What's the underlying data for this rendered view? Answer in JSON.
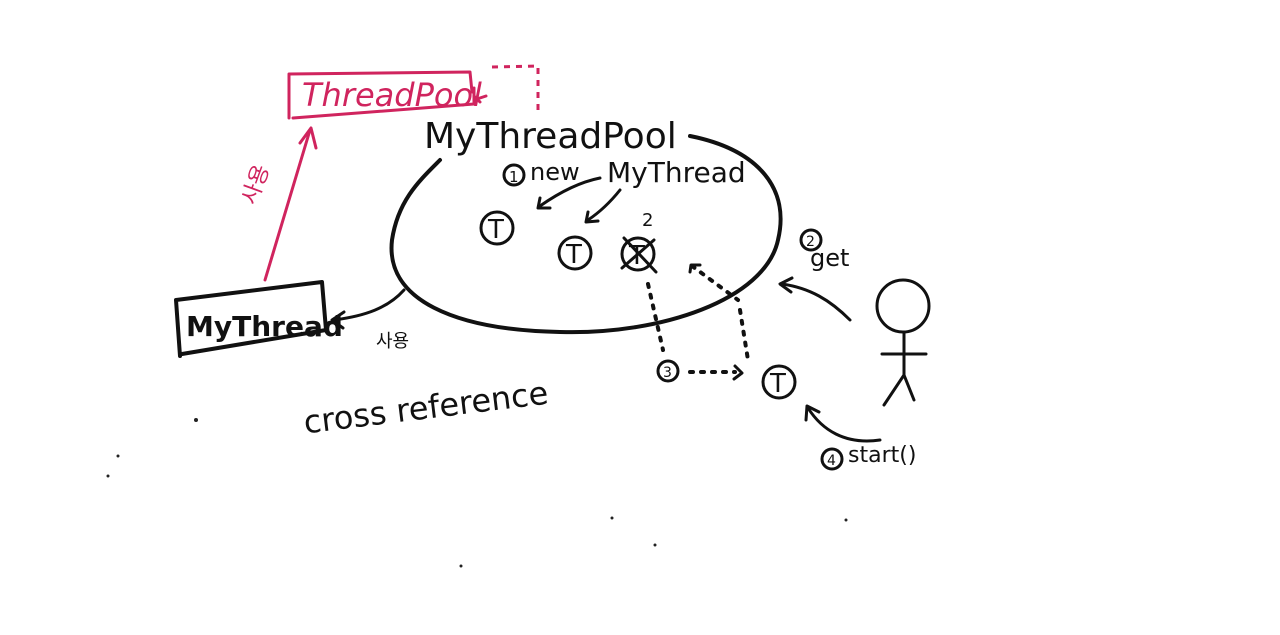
{
  "labels": {
    "threadpool_interface": "ThreadPool",
    "mythreadpool": "MyThreadPool",
    "mythread_class": "MyThread",
    "cross_reference": "cross reference",
    "step1_num": "1",
    "step1_text": "new",
    "mythread_in_pool": "MyThread",
    "step2_num": "2",
    "step2_text": "get",
    "step3_num": "3",
    "step4_num": "4",
    "step4_text": "start()",
    "uses_label_left": "사용",
    "uses_label_bottom": "사용",
    "thread_marker": "T",
    "taken_mark": "2"
  },
  "colors": {
    "ink": "#111111",
    "accent": "#d0245e"
  }
}
